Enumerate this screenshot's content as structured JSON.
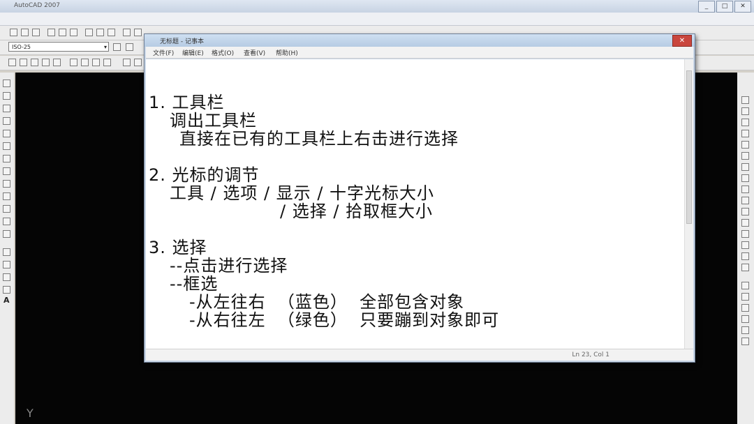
{
  "app": {
    "title": "AutoCAD 2007"
  },
  "notepad": {
    "title": "无标题 - 记事本",
    "menu": [
      "文件(F)",
      "编辑(E)",
      "格式(O)",
      "查看(V)",
      "帮助(H)"
    ],
    "status_position": "Ln 23, Col 1",
    "close_glyph": "✕",
    "lines": [
      "1. 工具栏",
      "调出工具栏",
      "直接在已有的工具栏上右击进行选择",
      "2. 光标的调节",
      "工具 / 选项 / 显示 / 十字光标大小",
      "/ 选择 / 拾取框大小",
      "3. 选择",
      "--点击进行选择",
      "--框选",
      "-从左往右  （蓝色）  全部包含对象",
      "-从右往左  （绿色）  只要蹦到对象即可"
    ]
  },
  "toolbar": {
    "layer_value": "ISO-25",
    "layer_arrow": "▾"
  },
  "canvas": {
    "axis_label": "Y"
  },
  "side_glyph": "A",
  "window_buttons": [
    "_",
    "□",
    "✕"
  ]
}
